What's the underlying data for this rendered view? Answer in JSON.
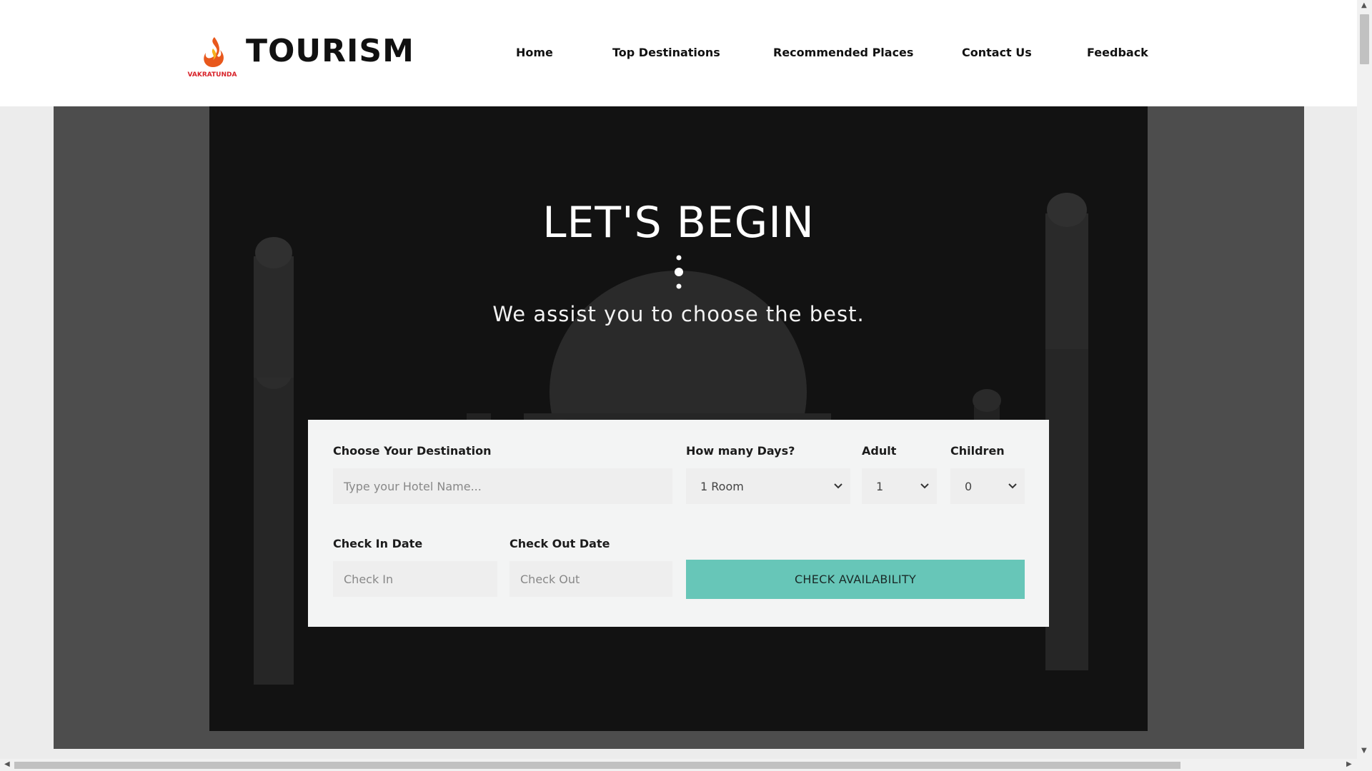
{
  "header": {
    "logo_text": "VAKRATUNDA",
    "brand": "TOURISM",
    "nav": [
      {
        "label": "Home"
      },
      {
        "label": "Top Destinations"
      },
      {
        "label": "Recommended Places"
      },
      {
        "label": "Contact Us"
      },
      {
        "label": "Feedback"
      }
    ]
  },
  "hero": {
    "title": "LET'S BEGIN",
    "subtitle": "We assist you to choose the best."
  },
  "booking": {
    "destination_label": "Choose Your Destination",
    "destination_placeholder": "Type your Hotel Name...",
    "days_label": "How many Days?",
    "days_value": "1 Room",
    "adult_label": "Adult",
    "adult_value": "1",
    "children_label": "Children",
    "children_value": "0",
    "checkin_label": "Check In Date",
    "checkin_placeholder": "Check In",
    "checkout_label": "Check Out Date",
    "checkout_placeholder": "Check Out",
    "button_label": "CHECK AVAILABILITY"
  },
  "colors": {
    "accent": "#67c6b8",
    "hero_bg": "#121212",
    "band": "#4d4d4d"
  }
}
